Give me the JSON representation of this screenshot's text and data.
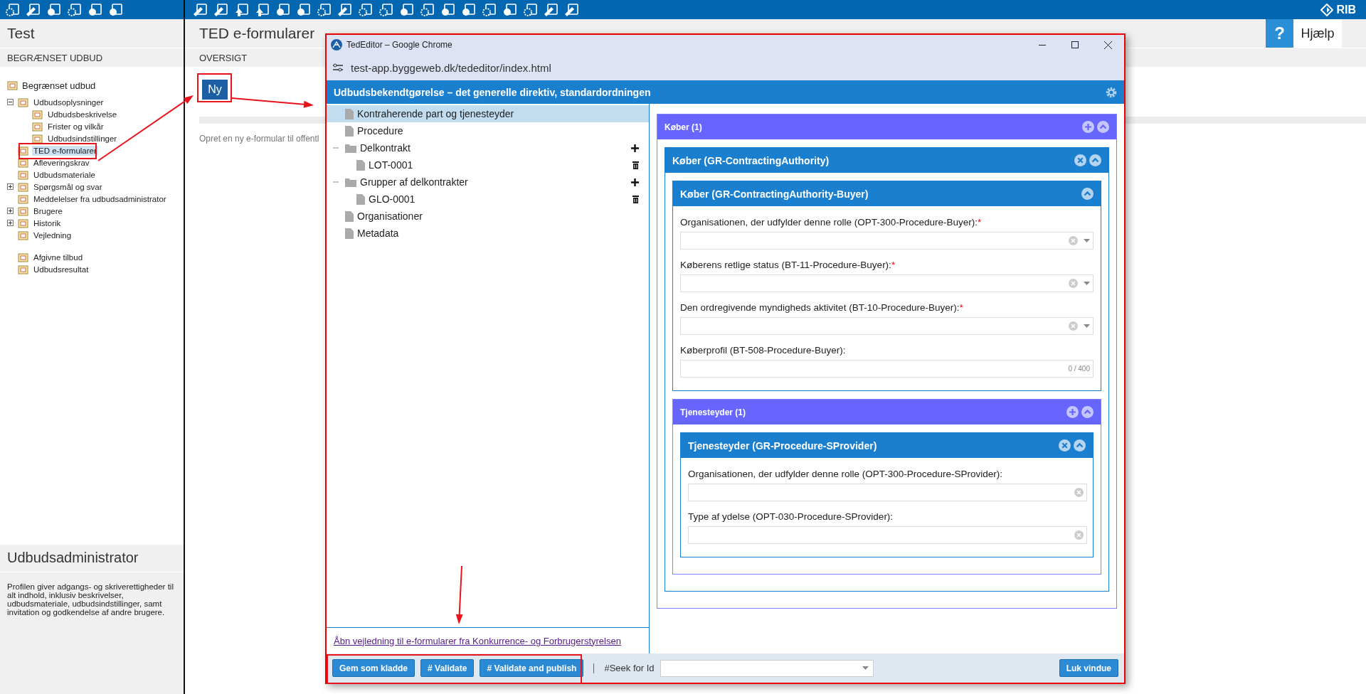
{
  "toolbar": {
    "logo": "RIB"
  },
  "sidebar": {
    "title": "Test",
    "section": "BEGRÆNSET UDBUD",
    "tree": {
      "label": "Begrænset udbud",
      "children": [
        {
          "label": "Udbudsoplysninger",
          "expanded": true,
          "selected": false,
          "children": [
            {
              "label": "Udbudsbeskrivelse",
              "selected": false
            },
            {
              "label": "Frister og vilkår",
              "selected": false
            },
            {
              "label": "Udbudsindstillinger",
              "selected": false
            }
          ]
        },
        {
          "label": "TED e-formularer",
          "selected": true
        },
        {
          "label": "Afleveringskrav",
          "selected": false
        },
        {
          "label": "Udbudsmateriale",
          "selected": false
        },
        {
          "label": "Spørgsmål og svar",
          "expanded": false,
          "selected": false
        },
        {
          "label": "Meddelelser fra udbudsadministrator",
          "selected": false
        },
        {
          "label": "Brugere",
          "expanded": false,
          "selected": false
        },
        {
          "label": "Historik",
          "expanded": false,
          "selected": false
        },
        {
          "label": "Vejledning",
          "selected": false
        },
        {
          "label": "Afgivne tilbud",
          "selected": false
        },
        {
          "label": "Udbudsresultat",
          "selected": false
        }
      ]
    },
    "profile": {
      "title": "Udbudsadministrator",
      "description": "Profilen giver adgangs- og skriverettigheder til alt indhold, inklusiv beskrivelser, udbudsmateriale, udbudsindstillinger, samt invitation og godkendelse af andre brugere."
    }
  },
  "main": {
    "title": "TED e-formularer",
    "section": "OVERSIGT",
    "new_button": "Ny",
    "hint": "Opret en ny e-formular til offentl"
  },
  "help": {
    "icon": "?",
    "label": "Hjælp"
  },
  "browser": {
    "title": "TedEditor – Google Chrome",
    "url": "test-app.byggeweb.dk/tededitor/index.html"
  },
  "editor": {
    "title": "Udbudsbekendtgørelse – det generelle direktiv, standardordningen",
    "tree": [
      {
        "label": "Kontraherende part og tjenesteyder",
        "kind": "page",
        "selected": true,
        "add": false,
        "delete": false
      },
      {
        "label": "Procedure",
        "kind": "page",
        "selected": false,
        "add": false,
        "delete": false
      },
      {
        "label": "Delkontrakt",
        "kind": "folder",
        "selected": false,
        "expanded": true,
        "add": true,
        "delete": false,
        "children": [
          {
            "label": "LOT-0001",
            "kind": "page",
            "selected": false,
            "add": false,
            "delete": true
          }
        ]
      },
      {
        "label": "Grupper af delkontrakter",
        "kind": "folder",
        "selected": false,
        "expanded": true,
        "add": true,
        "delete": false,
        "children": [
          {
            "label": "GLO-0001",
            "kind": "page",
            "selected": false,
            "add": false,
            "delete": true
          }
        ]
      },
      {
        "label": "Organisationer",
        "kind": "page",
        "selected": false,
        "add": false,
        "delete": false
      },
      {
        "label": "Metadata",
        "kind": "page",
        "selected": false,
        "add": false,
        "delete": false
      }
    ],
    "guide_link": "Åbn vejledning til e-formularer fra Konkurrence- og Forbrugerstyrelsen",
    "sections": [
      {
        "title": "Køber (1)",
        "kind": "group",
        "add": true,
        "remove": false,
        "collapse": true,
        "children": [
          {
            "title": "Køber (GR-ContractingAuthority)",
            "kind": "instance",
            "add": false,
            "remove": true,
            "collapse": true,
            "children": [
              {
                "title": "Køber (GR-ContractingAuthority-Buyer)",
                "kind": "subgroup",
                "add": false,
                "remove": false,
                "collapse": true,
                "fields": [
                  {
                    "label": "Organisationen, der udfylder denne rolle (OPT-300-Procedure-Buyer):",
                    "required_mark": "*",
                    "kind": "select"
                  },
                  {
                    "label": "Køberens retlige status (BT-11-Procedure-Buyer):",
                    "required_mark": "*",
                    "kind": "select"
                  },
                  {
                    "label": "Den ordregivende myndigheds aktivitet (BT-10-Procedure-Buyer):",
                    "required_mark": "*",
                    "kind": "select"
                  },
                  {
                    "label": "Køberprofil (BT-508-Procedure-Buyer):",
                    "kind": "text",
                    "counter": "0 / 400"
                  }
                ]
              },
              {
                "title": "Tjenesteyder (1)",
                "kind": "group",
                "add": true,
                "remove": false,
                "collapse": true,
                "children": [
                  {
                    "title": "Tjenesteyder (GR-Procedure-SProvider)",
                    "kind": "instance",
                    "add": false,
                    "remove": true,
                    "collapse": true,
                    "fields": [
                      {
                        "label": "Organisationen, der udfylder denne rolle (OPT-300-Procedure-SProvider):",
                        "kind": "clearable"
                      },
                      {
                        "label": "Type af ydelse (OPT-030-Procedure-SProvider):",
                        "kind": "clearable"
                      }
                    ]
                  }
                ]
              }
            ]
          }
        ]
      }
    ],
    "footer": {
      "buttons": [
        "Gem som kladde",
        "# Validate",
        "# Validate and publish"
      ],
      "seek_label": "#Seek for Id",
      "close_button": "Luk vindue"
    }
  }
}
